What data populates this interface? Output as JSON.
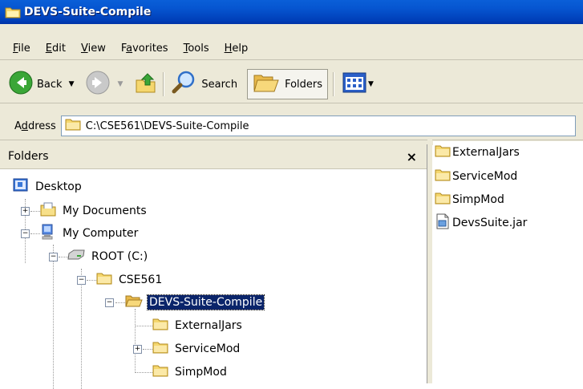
{
  "window": {
    "title": "DEVS-Suite-Compile"
  },
  "menu": [
    {
      "label": "File",
      "key": "F",
      "rest": "ile"
    },
    {
      "label": "Edit",
      "key": "E",
      "rest": "dit"
    },
    {
      "label": "View",
      "key": "V",
      "rest": "iew"
    },
    {
      "label": "Favorites",
      "pre": "F",
      "key": "a",
      "rest": "vorites"
    },
    {
      "label": "Tools",
      "key": "T",
      "rest": "ools"
    },
    {
      "label": "Help",
      "key": "H",
      "rest": "elp"
    }
  ],
  "toolbar": {
    "back_label": "Back",
    "search_label": "Search",
    "folders_label": "Folders"
  },
  "address": {
    "label_pre": "A",
    "label_key": "d",
    "label_rest": "dress",
    "value": "C:\\CSE561\\DEVS-Suite-Compile"
  },
  "folders_pane": {
    "title": "Folders",
    "close_glyph": "×",
    "tree": {
      "desktop": "Desktop",
      "my_documents": "My Documents",
      "my_computer": "My Computer",
      "root": "ROOT (C:)",
      "cse561": "CSE561",
      "devs": "DEVS-Suite-Compile",
      "external": "ExternalJars",
      "service": "ServiceMod",
      "simp": "SimpMod"
    }
  },
  "contents": [
    {
      "name": "ExternalJars",
      "type": "folder"
    },
    {
      "name": "ServiceMod",
      "type": "folder"
    },
    {
      "name": "SimpMod",
      "type": "folder"
    },
    {
      "name": "DevsSuite.jar",
      "type": "file"
    }
  ]
}
